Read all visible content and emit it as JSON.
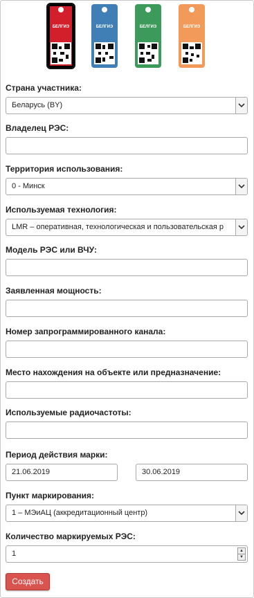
{
  "tags": [
    {
      "color": "#d31f2c",
      "brand": "БЕЛГИЭ"
    },
    {
      "color": "#3f7fb5",
      "brand": "БЕЛГИЭ"
    },
    {
      "color": "#3c9a5b",
      "brand": "БЕЛГИЭ"
    },
    {
      "color": "#f19a5a",
      "brand": "БЕЛГИЭ"
    }
  ],
  "form": {
    "country": {
      "label": "Страна участника:",
      "value": "Беларусь (BY)"
    },
    "owner": {
      "label": "Владелец РЭС:",
      "value": ""
    },
    "territory": {
      "label": "Территория использования:",
      "value": "0 - Минск"
    },
    "technology": {
      "label": "Используемая технология:",
      "value": "LMR – оперативная, технологическая и пользовательская р"
    },
    "model": {
      "label": "Модель РЭС или ВЧУ:",
      "value": ""
    },
    "power": {
      "label": "Заявленная мощность:",
      "value": ""
    },
    "channel": {
      "label": "Номер запрограммированного канала:",
      "value": ""
    },
    "location": {
      "label": "Место нахождения на объекте или предназначение:",
      "value": ""
    },
    "frequencies": {
      "label": "Используемые радиочастоты:",
      "value": ""
    },
    "period": {
      "label": "Период действия марки:",
      "from": "21.06.2019",
      "to": "30.06.2019"
    },
    "point": {
      "label": "Пункт маркирования:",
      "value": "1 – МЭиАЦ (аккредитационный центр)"
    },
    "quantity": {
      "label": "Количество маркируемых РЭС:",
      "value": "1"
    }
  },
  "create_button": "Создать",
  "colors": {
    "accent": "#d9534f",
    "border": "#aaaaaa"
  }
}
